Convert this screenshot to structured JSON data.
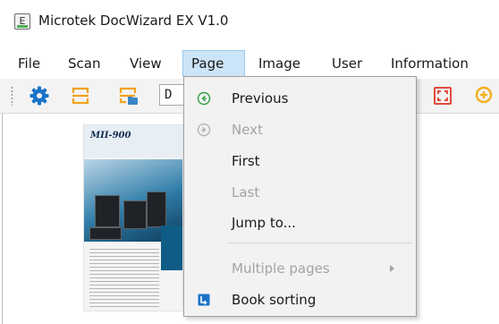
{
  "window": {
    "app_icon_letter": "E",
    "title": "Microtek DocWizard EX V1.0"
  },
  "menubar": {
    "items": [
      "File",
      "Scan",
      "View",
      "Page",
      "Image",
      "User",
      "Information"
    ],
    "active": "Page"
  },
  "toolbar": {
    "buttons": [
      "settings-icon",
      "scan-area-icon",
      "scan-to-folder-icon",
      "fit-page-icon",
      "zoom-in-icon"
    ],
    "combo_value": "D"
  },
  "thumbnail": {
    "headline": "MII-900"
  },
  "page_menu": {
    "items": [
      {
        "label": "Previous",
        "enabled": true,
        "icon": "previous-circle-icon"
      },
      {
        "label": "Next",
        "enabled": false,
        "icon": "next-circle-icon"
      },
      {
        "label": "First",
        "enabled": true
      },
      {
        "label": "Last",
        "enabled": false
      },
      {
        "label": "Jump to...",
        "enabled": true
      },
      {
        "label": "Multiple pages",
        "enabled": false,
        "has_submenu": true
      },
      {
        "label": "Book sorting",
        "enabled": true,
        "icon": "book-sorting-icon"
      }
    ]
  },
  "colors": {
    "accent_blue": "#1a73c9",
    "toolbar_orange": "#f2a21c",
    "zoom_red": "#e24b3b",
    "zoom_yellow": "#f2b01e",
    "menu_highlight": "#cce4f7",
    "disabled_text": "#a3a3a3"
  }
}
